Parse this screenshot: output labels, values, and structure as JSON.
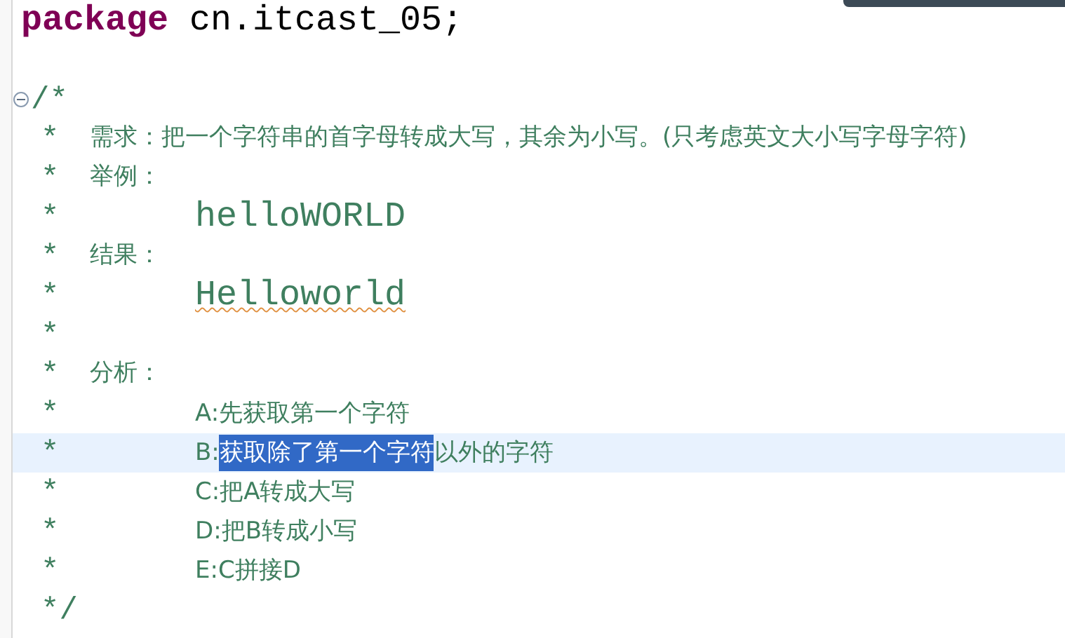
{
  "editor": {
    "lines": [
      {
        "kind": "package",
        "keyword": "package",
        "text": "cn.itcast_05;",
        "current": false
      },
      {
        "kind": "blank",
        "current": false
      },
      {
        "kind": "open",
        "marker": "/*",
        "fold_expanded": true,
        "current": false
      },
      {
        "kind": "heading",
        "marker": "*",
        "text": "需求：把一个字符串的首字母转成大写，其余为小写。(只考虑英文大小写字母字符)",
        "current": false
      },
      {
        "kind": "heading",
        "marker": "*",
        "text": "举例：",
        "current": false
      },
      {
        "kind": "sample",
        "marker": "*",
        "text": "helloWORLD",
        "misspelled": false,
        "current": false
      },
      {
        "kind": "heading",
        "marker": "*",
        "text": "结果：",
        "current": false
      },
      {
        "kind": "sample",
        "marker": "*",
        "text": "Helloworld",
        "misspelled": true,
        "current": false
      },
      {
        "kind": "marker",
        "marker": "*",
        "current": false
      },
      {
        "kind": "heading",
        "marker": "*",
        "text": "分析：",
        "current": false
      },
      {
        "kind": "step",
        "marker": "*",
        "segments": [
          {
            "text": "A:先获取第一个字符",
            "selected": false
          }
        ],
        "current": false
      },
      {
        "kind": "step",
        "marker": "*",
        "segments": [
          {
            "text": "B:",
            "selected": false
          },
          {
            "text": "获取除了第一个字符",
            "selected": true
          },
          {
            "text": "以外的字符",
            "selected": false
          }
        ],
        "current": true
      },
      {
        "kind": "step",
        "marker": "*",
        "segments": [
          {
            "text": "C:把A转成大写",
            "selected": false
          }
        ],
        "current": false
      },
      {
        "kind": "step",
        "marker": "*",
        "segments": [
          {
            "text": "D:把B转成小写",
            "selected": false
          }
        ],
        "current": false
      },
      {
        "kind": "step",
        "marker": "*",
        "segments": [
          {
            "text": "E:C拼接D",
            "selected": false
          }
        ],
        "current": false
      },
      {
        "kind": "close",
        "marker": "*/",
        "current": false
      }
    ]
  }
}
